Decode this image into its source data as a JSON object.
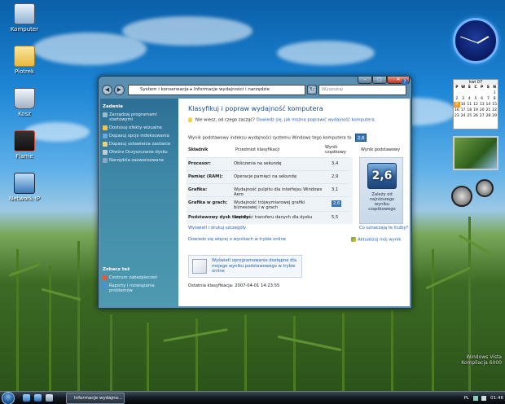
{
  "desktop": {
    "icons": [
      {
        "label": "Komputer",
        "color": "#cfe3f5"
      },
      {
        "label": "Piotrek",
        "color": "#f5d66a"
      },
      {
        "label": "Kosz",
        "color": "#d7e4ef"
      },
      {
        "label": "Flame",
        "color": "#e04a2a"
      },
      {
        "label": "Network-IP",
        "color": "#6aa6dd"
      }
    ],
    "brand_line1": "Windows Vista",
    "brand_line2": "Kompilacja 6000"
  },
  "calendar": {
    "title": "kwi 07",
    "days": [
      "P",
      "W",
      "Ś",
      "C",
      "P",
      "S",
      "N"
    ],
    "dates": [
      "",
      "",
      "",
      "",
      "",
      "",
      "1",
      "2",
      "3",
      "4",
      "5",
      "6",
      "7",
      "8",
      "9",
      "10",
      "11",
      "12",
      "13",
      "14",
      "15",
      "16",
      "17",
      "18",
      "19",
      "20",
      "21",
      "22",
      "23",
      "24",
      "25",
      "26",
      "27",
      "28",
      "29"
    ],
    "today": "9"
  },
  "window": {
    "address": {
      "crumb1": "System i konserwacja",
      "separator": "▸",
      "crumb2": "Informacje wydajności i narzędzie"
    },
    "search_placeholder": "Wyszukaj",
    "left_pane": {
      "tasks_title": "Zadania",
      "tasks": [
        {
          "label": "Zarządzaj programami startowymi",
          "color": "#9bc"
        },
        {
          "label": "Dostosuj efekty wizualne",
          "color": "#f7c24b"
        },
        {
          "label": "Dopasuj opcje indeksowania",
          "color": "#6aa8e0"
        },
        {
          "label": "Dopasuj ustawienia zasilania",
          "color": "#e8d27a"
        },
        {
          "label": "Otwórz Oczyszczanie dysku",
          "color": "#c5ccd4"
        },
        {
          "label": "Narzędzia zaawansowane",
          "color": "#8aa9c8"
        }
      ],
      "see_also_title": "Zobacz też",
      "see_also": [
        {
          "label": "Centrum zabezpieczeń",
          "color": "#e05a40"
        },
        {
          "label": "Raporty i rozwiązania problemów",
          "color": "#4f8fd6"
        }
      ]
    },
    "content": {
      "title": "Klasyfikuj i popraw wydajność komputera",
      "hint_static": "Nie wiesz, od czego zacząć?",
      "hint_link": "Dowiedz się, jak można poprawić wydajność komputera.",
      "base_score_label": "Wynik podstawowy indeksu wydajności systemu Windows tego komputera to",
      "base_score": "2,6",
      "headers": {
        "component": "Składnik",
        "rated": "Przedmiot klasyfikacji",
        "subscore": "Wynik cząstkowy",
        "basescore": "Wynik podstawowy"
      },
      "rows": [
        {
          "component": "Procesor:",
          "rated": "Obliczenia na sekundę",
          "score": "3,4"
        },
        {
          "component": "Pamięć (RAM):",
          "rated": "Operacje pamięci na sekundę",
          "score": "2,9"
        },
        {
          "component": "Grafika:",
          "rated": "Wydajność pulpitu dla interfejsu Windows Aero",
          "score": "3,1"
        },
        {
          "component": "Grafika w grach:",
          "rated": "Wydajność trójwymiarowej grafiki biznesowej i w grach",
          "score": "2,6"
        },
        {
          "component": "Podstawowy dysk twardy:",
          "rated": "Szybkość transferu danych dla dysku",
          "score": "5,5"
        }
      ],
      "big_score": "2,6",
      "big_note": "Zależy od najniższego wyniku cząstkowego",
      "link_details": "Wyświetl i drukuj szczegóły",
      "link_meaning": "Co oznaczają te liczby?",
      "link_learn_online": "Dowiedz się więcej o wynikach w trybie online",
      "link_update": "Aktualizuj mój wynik",
      "software_link": "Wyświetl oprogramowanie dostępne dla mojego wyniku podstawowego w trybie online",
      "last_rating": "Ostatnia klasyfikacja: 2007-04-01 14:23:55"
    }
  },
  "taskbar": {
    "task_label": "Informacje wydajno...",
    "lang": "PL",
    "time": "01:46"
  }
}
